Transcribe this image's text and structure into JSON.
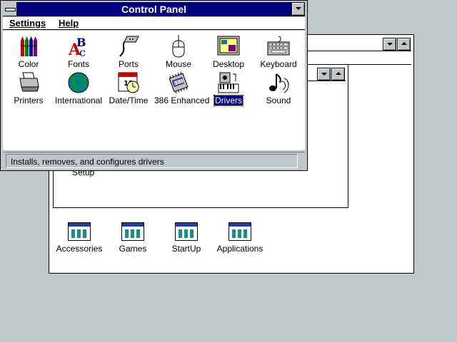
{
  "program_manager": {
    "group_icons": [
      {
        "label": "Accessories",
        "icon": "program-group-icon"
      },
      {
        "label": "Games",
        "icon": "program-group-icon"
      },
      {
        "label": "StartUp",
        "icon": "program-group-icon"
      },
      {
        "label": "Applications",
        "icon": "program-group-icon"
      }
    ],
    "main_group": {
      "partial_label": "Setup"
    }
  },
  "control_panel": {
    "title": "Control Panel",
    "menu": [
      {
        "label": "Settings"
      },
      {
        "label": "Help"
      }
    ],
    "icons": [
      {
        "label": "Color",
        "icon": "color-crayons-icon"
      },
      {
        "label": "Fonts",
        "icon": "fonts-icon"
      },
      {
        "label": "Ports",
        "icon": "ports-connector-icon"
      },
      {
        "label": "Mouse",
        "icon": "mouse-icon"
      },
      {
        "label": "Desktop",
        "icon": "desktop-icon"
      },
      {
        "label": "Keyboard",
        "icon": "keyboard-icon"
      },
      {
        "label": "Printers",
        "icon": "printer-icon"
      },
      {
        "label": "International",
        "icon": "globe-icon"
      },
      {
        "label": "Date/Time",
        "icon": "clock-calendar-icon"
      },
      {
        "label": "386 Enhanced",
        "icon": "chip-386-icon"
      },
      {
        "label": "Drivers",
        "icon": "drivers-icon",
        "selected": true
      },
      {
        "label": "Sound",
        "icon": "sound-note-icon"
      }
    ],
    "status": "Installs, removes, and configures drivers"
  },
  "colors": {
    "desktop": "#c0c7c8",
    "active_title": "#000080",
    "selection": "#000080"
  }
}
